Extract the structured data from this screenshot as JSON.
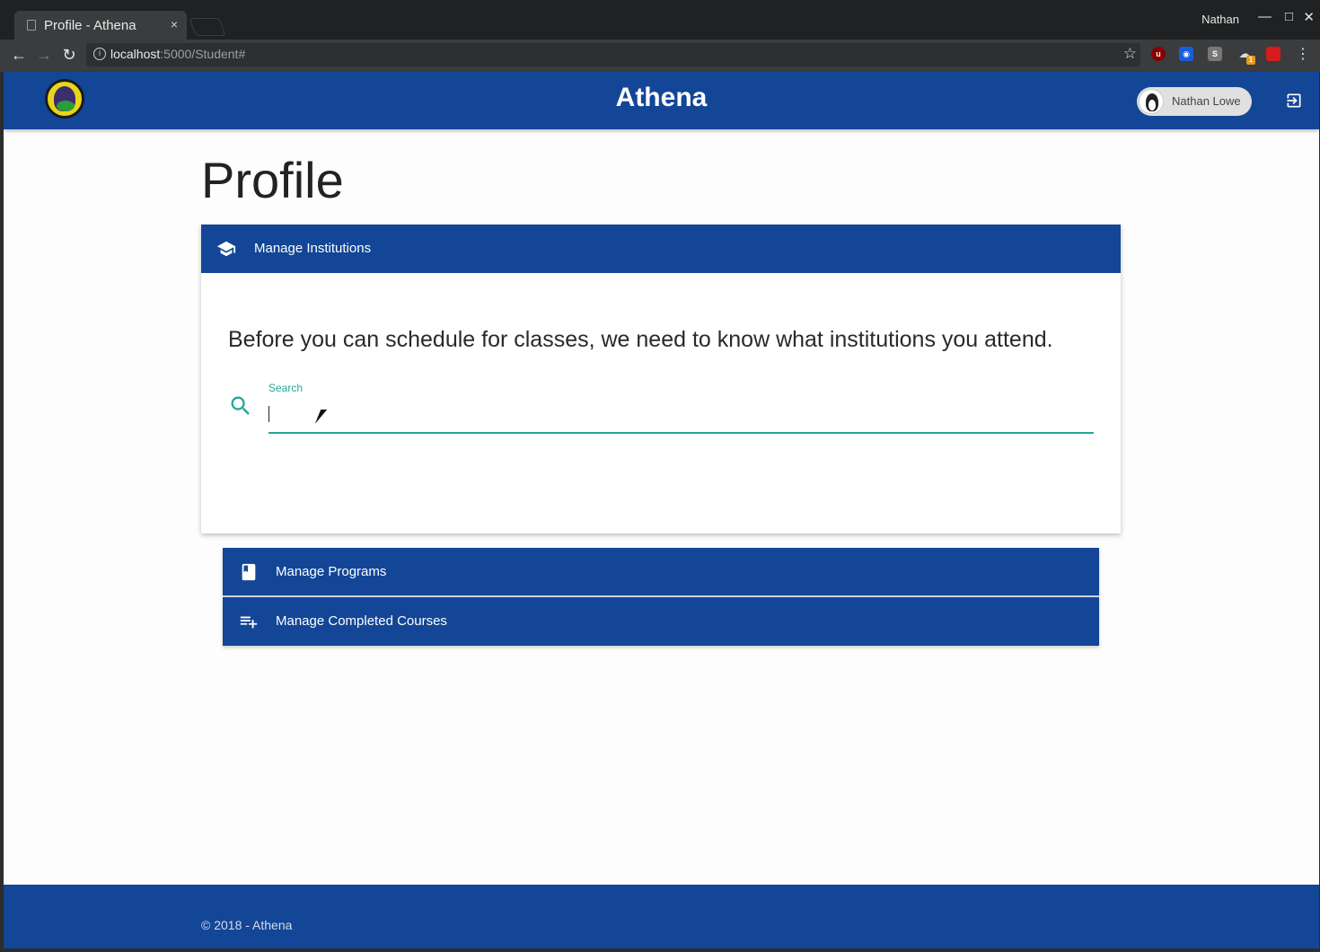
{
  "browser": {
    "tab_title": "Profile - Athena",
    "tab_close": "×",
    "window_user": "Nathan",
    "url_host": "localhost",
    "url_rest": ":5000/Student#",
    "extensions": [
      "ublock",
      "bitwarden",
      "stylus",
      "weather",
      "box"
    ],
    "extension_badge": "1"
  },
  "app": {
    "name": "Athena",
    "user_chip": "Nathan Lowe",
    "brand_color": "#134696",
    "accent_color": "#26a69a"
  },
  "page": {
    "title": "Profile"
  },
  "institutions": {
    "header": "Manage Institutions",
    "icon": "graduation-cap-icon",
    "lead": "Before you can schedule for classes, we need to know what institutions you attend.",
    "search_label": "Search",
    "search_value": ""
  },
  "sections": [
    {
      "label": "Manage Programs",
      "icon": "book-icon"
    },
    {
      "label": "Manage Completed Courses",
      "icon": "playlist-add-icon"
    }
  ],
  "footer": {
    "copyright": "© 2018 - Athena"
  }
}
